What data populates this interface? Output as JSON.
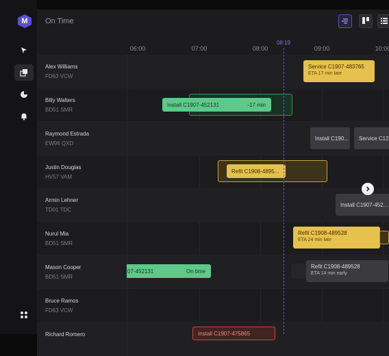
{
  "app": {
    "logo_letter": "M"
  },
  "sidebar": {
    "items": [
      {
        "name": "pointer-icon",
        "active": false
      },
      {
        "name": "layers-icon",
        "active": true
      },
      {
        "name": "pie-chart-icon",
        "active": false
      },
      {
        "name": "bell-icon",
        "active": false
      },
      {
        "name": "apps-grid-icon",
        "active": false
      }
    ]
  },
  "header": {
    "title": "On Time"
  },
  "view_buttons": [
    {
      "name": "timeline-view-icon",
      "active": true
    },
    {
      "name": "board-view-icon",
      "active": false
    },
    {
      "name": "list-view-icon",
      "active": false
    }
  ],
  "timeline": {
    "ticks": [
      "06:00",
      "07:00",
      "08:00",
      "09:00",
      "10:00"
    ],
    "now": "08:19"
  },
  "rows": [
    {
      "name": "Alex Williams",
      "reg": "FD63 VCW"
    },
    {
      "name": "Billy Walters",
      "reg": "BD51 SMR"
    },
    {
      "name": "Raymond Estrada",
      "reg": "EW96 QXD"
    },
    {
      "name": "Justin Douglas",
      "reg": "HV57 VAM"
    },
    {
      "name": "Armin Lehner",
      "reg": "TD01 TDC"
    },
    {
      "name": "Nurul Mia",
      "reg": "BD51 SMR"
    },
    {
      "name": "Mason Cooper",
      "reg": "BD51 SMR"
    },
    {
      "name": "Bruce Ramos",
      "reg": "FD63 VCW"
    },
    {
      "name": "Richard Romero",
      "reg": ""
    }
  ],
  "jobs": [
    {
      "title": "Service C1907-483765",
      "sub": "ETA 17 min late"
    },
    {
      "title": "Install C1907-452131",
      "status": "-17 min"
    },
    {
      "title": "Install C190..."
    },
    {
      "title": "Service C12..."
    },
    {
      "title": "Refit C1908-4895..."
    },
    {
      "title": "Install C1907-452..."
    },
    {
      "title": "Refit C1908-489528",
      "sub": "ETA 24 min late"
    },
    {
      "title": "07-452131",
      "status": "On time"
    },
    {
      "title": "Refit C1908-489528",
      "sub": "ETA 14 min early"
    },
    {
      "title": "Install C1907-475865"
    }
  ]
}
